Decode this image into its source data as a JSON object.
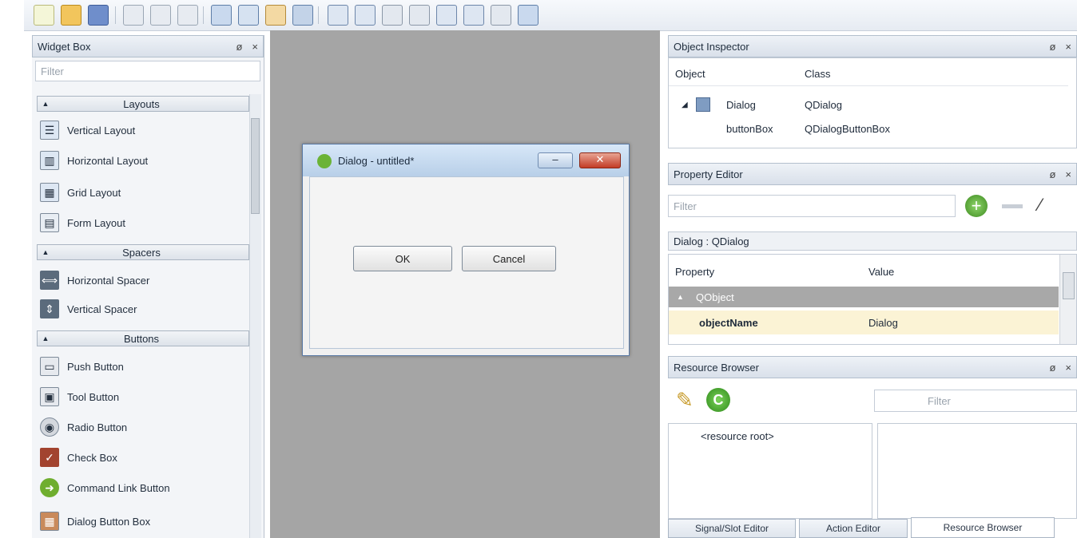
{
  "widget_box": {
    "title": "Widget Box",
    "filter_placeholder": "Filter",
    "categories": [
      {
        "label": "Layouts",
        "items": [
          "Vertical Layout",
          "Horizontal Layout",
          "Grid Layout",
          "Form Layout"
        ]
      },
      {
        "label": "Spacers",
        "items": [
          "Horizontal Spacer",
          "Vertical Spacer"
        ]
      },
      {
        "label": "Buttons",
        "items": [
          "Push Button",
          "Tool Button",
          "Radio Button",
          "Check Box",
          "Command Link Button",
          "Dialog Button Box"
        ]
      }
    ]
  },
  "dock_buttons": {
    "float": "ø",
    "close": "×"
  },
  "dialog": {
    "title": "Dialog - untitled*",
    "ok_label": "OK",
    "cancel_label": "Cancel"
  },
  "object_inspector": {
    "title": "Object Inspector",
    "columns": [
      "Object",
      "Class"
    ],
    "rows": [
      {
        "object": "Dialog",
        "class": "QDialog"
      },
      {
        "object": "buttonBox",
        "class": "QDialogButtonBox"
      }
    ]
  },
  "property_editor": {
    "title": "Property Editor",
    "filter_placeholder": "Filter",
    "context": "Dialog : QDialog",
    "columns": [
      "Property",
      "Value"
    ],
    "group": "QObject",
    "property": "objectName",
    "value": "Dialog"
  },
  "resource_browser": {
    "title": "Resource Browser",
    "filter_placeholder": "Filter",
    "root": "<resource root>"
  },
  "bottom_tabs": [
    "Signal/Slot Editor",
    "Action Editor",
    "Resource Browser"
  ],
  "colors": {
    "accent": "#3b6ea5",
    "selection": "#a8a8a8",
    "highlight_row": "#fbf3d5"
  }
}
